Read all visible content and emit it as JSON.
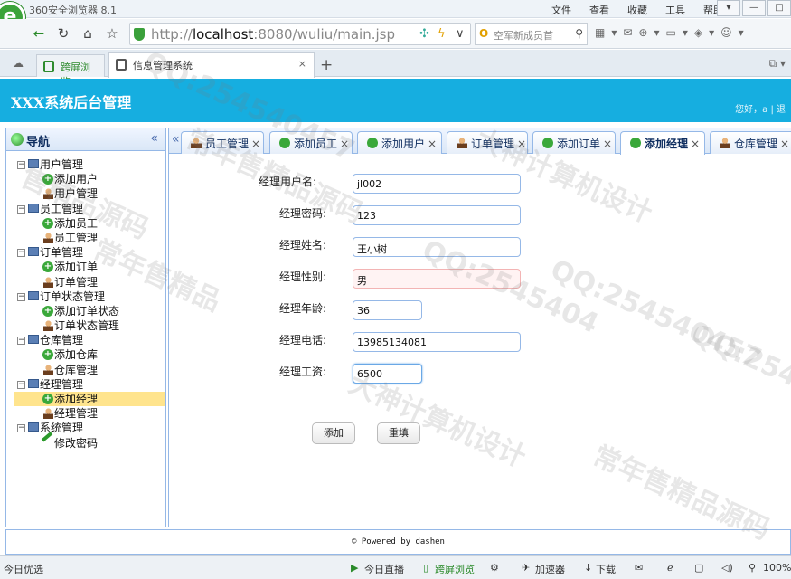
{
  "browser": {
    "title": "360安全浏览器 8.1",
    "menus": [
      "文件",
      "查看",
      "收藏",
      "工具",
      "帮助"
    ],
    "url_prefix": "http://",
    "url_host": "localhost",
    "url_rest": ":8080/wuliu/main.jsp",
    "search_placeholder": "空军新成员首",
    "tabs": [
      {
        "label": "跨屏浏览"
      },
      {
        "label": "信息管理系统",
        "close": "×"
      }
    ]
  },
  "app": {
    "title": "XXX系统后台管理",
    "greeting": "您好，a | 退"
  },
  "sidebar": {
    "title": "导航",
    "collapse": "«",
    "groups": [
      {
        "label": "用户管理",
        "items": [
          {
            "label": "添加用户",
            "icon": "plus"
          },
          {
            "label": "用户管理",
            "icon": "user"
          }
        ]
      },
      {
        "label": "员工管理",
        "items": [
          {
            "label": "添加员工",
            "icon": "plus"
          },
          {
            "label": "员工管理",
            "icon": "user"
          }
        ]
      },
      {
        "label": "订单管理",
        "items": [
          {
            "label": "添加订单",
            "icon": "plus"
          },
          {
            "label": "订单管理",
            "icon": "user"
          }
        ]
      },
      {
        "label": "订单状态管理",
        "items": [
          {
            "label": "添加订单状态",
            "icon": "plus"
          },
          {
            "label": "订单状态管理",
            "icon": "user"
          }
        ]
      },
      {
        "label": "仓库管理",
        "items": [
          {
            "label": "添加仓库",
            "icon": "plus"
          },
          {
            "label": "仓库管理",
            "icon": "user"
          }
        ]
      },
      {
        "label": "经理管理",
        "items": [
          {
            "label": "添加经理",
            "icon": "plus",
            "selected": true
          },
          {
            "label": "经理管理",
            "icon": "user"
          }
        ]
      },
      {
        "label": "系统管理",
        "items": [
          {
            "label": "修改密码",
            "icon": "pencil"
          }
        ]
      }
    ]
  },
  "content_tabs": [
    {
      "label": "员工管理",
      "icon": "user"
    },
    {
      "label": "添加员工",
      "icon": "plus"
    },
    {
      "label": "添加用户",
      "icon": "plus"
    },
    {
      "label": "订单管理",
      "icon": "user"
    },
    {
      "label": "添加订单",
      "icon": "plus"
    },
    {
      "label": "添加经理",
      "icon": "plus",
      "active": true
    },
    {
      "label": "仓库管理",
      "icon": "user"
    }
  ],
  "form": {
    "fields": [
      {
        "label": "经理用户名:",
        "value": "jl002"
      },
      {
        "label": "经理密码:",
        "value": "123"
      },
      {
        "label": "经理姓名:",
        "value": "王小树"
      },
      {
        "label": "经理性别:",
        "value": "男"
      },
      {
        "label": "经理年龄:",
        "value": "36"
      },
      {
        "label": "经理电话:",
        "value": "13985134081"
      },
      {
        "label": "经理工资:",
        "value": "6500"
      }
    ],
    "submit": "添加",
    "reset": "重填"
  },
  "footer": "© Powered by dashen",
  "statusbar": {
    "left": "今日优选",
    "live": "今日直播",
    "cross": "跨屏浏览",
    "accel": "加速器",
    "download": "下载",
    "zoom": "100%"
  },
  "watermarks": [
    "QQ:254540457",
    "大神计算机设计",
    "常年售精品源码",
    "售精品源码",
    "QQ:2545404",
    "常年售精品",
    "大神计算机设计",
    "QQ:254540457",
    "常年售精品源码",
    "QQ:2545"
  ]
}
